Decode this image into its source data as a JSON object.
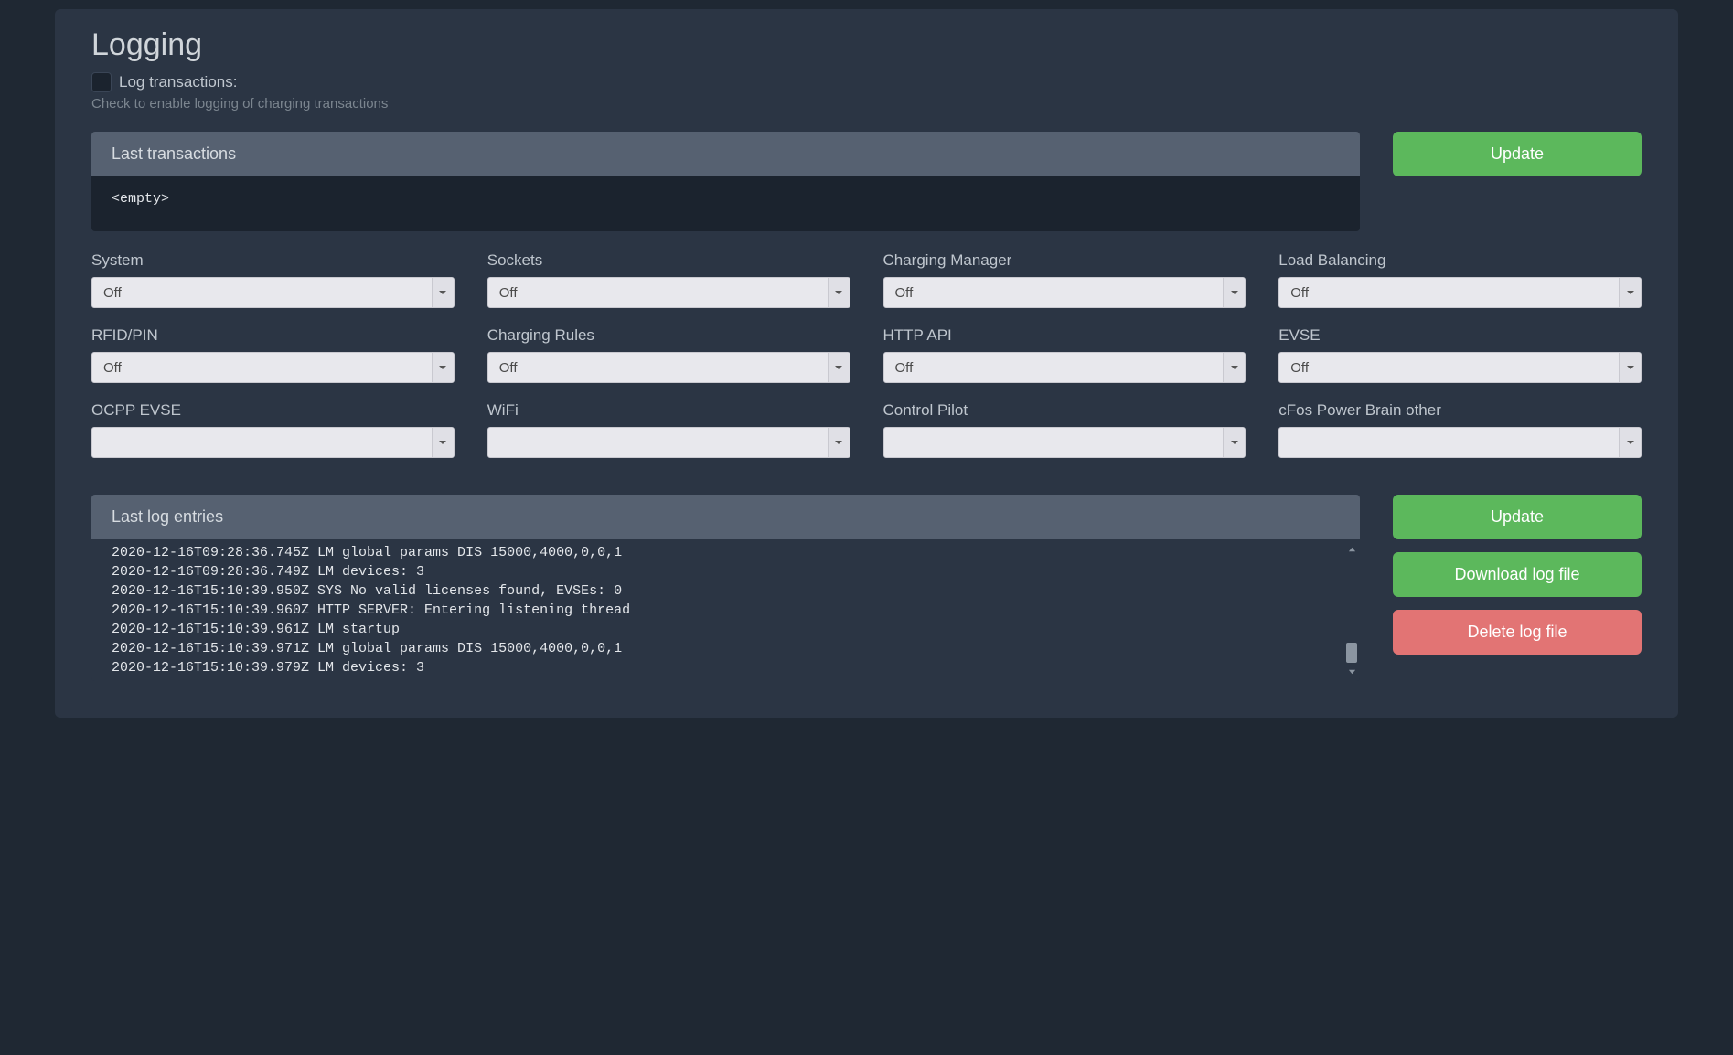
{
  "title": "Logging",
  "log_transactions_label": "Log transactions:",
  "log_transactions_hint": "Check to enable logging of charging transactions",
  "last_transactions_header": "Last transactions",
  "last_transactions_body": "<empty>",
  "update_button": "Update",
  "selects": {
    "system": {
      "label": "System",
      "value": "Off"
    },
    "sockets": {
      "label": "Sockets",
      "value": "Off"
    },
    "charging_mgr": {
      "label": "Charging Manager",
      "value": "Off"
    },
    "load_balancing": {
      "label": "Load Balancing",
      "value": "Off"
    },
    "rfid_pin": {
      "label": "RFID/PIN",
      "value": "Off"
    },
    "charging_rules": {
      "label": "Charging Rules",
      "value": "Off"
    },
    "http_api": {
      "label": "HTTP API",
      "value": "Off"
    },
    "evse": {
      "label": "EVSE",
      "value": "Off"
    },
    "ocpp_evse": {
      "label": "OCPP EVSE",
      "value": ""
    },
    "wifi": {
      "label": "WiFi",
      "value": ""
    },
    "control_pilot": {
      "label": "Control Pilot",
      "value": ""
    },
    "cfos_other": {
      "label": "cFos Power Brain other",
      "value": ""
    }
  },
  "last_log_header": "Last log entries",
  "log_lines": [
    "2020-12-16T09:28:36.745Z LM global params DIS 15000,4000,0,0,1",
    "2020-12-16T09:28:36.749Z LM devices: 3",
    "2020-12-16T15:10:39.950Z SYS No valid licenses found, EVSEs: 0",
    "2020-12-16T15:10:39.960Z HTTP SERVER: Entering listening thread",
    "2020-12-16T15:10:39.961Z LM startup",
    "2020-12-16T15:10:39.971Z LM global params DIS 15000,4000,0,0,1",
    "2020-12-16T15:10:39.979Z LM devices: 3"
  ],
  "download_log_button": "Download log file",
  "delete_log_button": "Delete log file"
}
